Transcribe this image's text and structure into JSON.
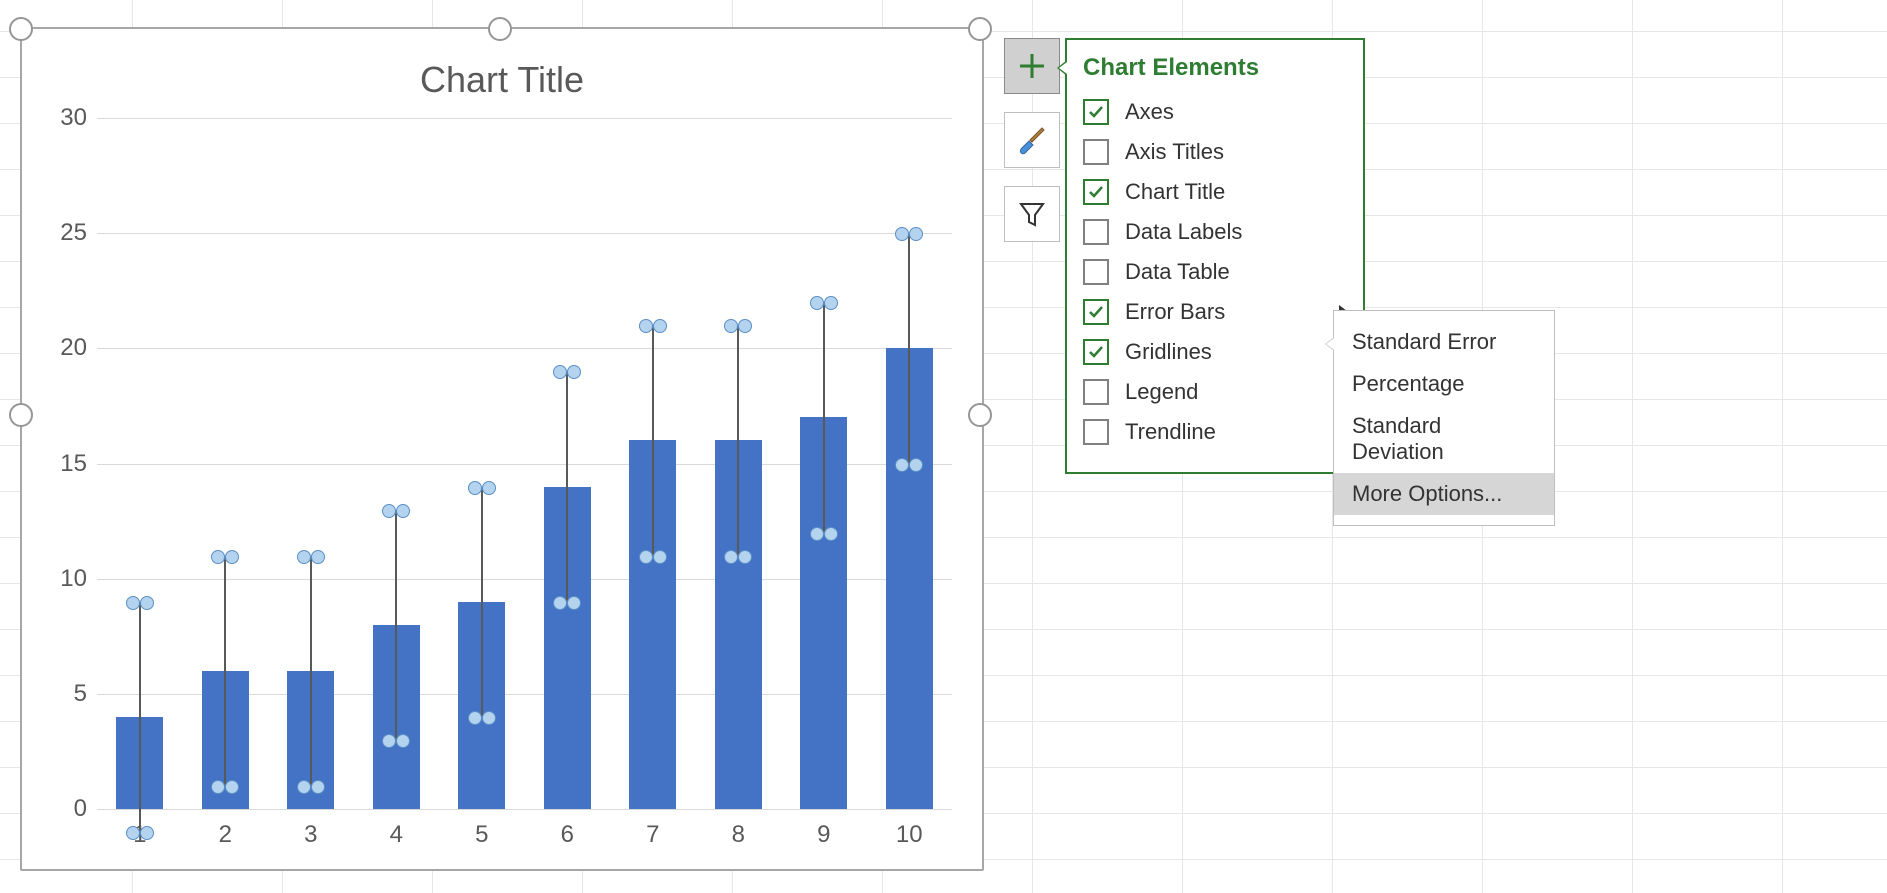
{
  "chart_data": {
    "type": "bar",
    "title": "Chart Title",
    "categories": [
      "1",
      "2",
      "3",
      "4",
      "5",
      "6",
      "7",
      "8",
      "9",
      "10"
    ],
    "values": [
      4,
      6,
      6,
      8,
      9,
      14,
      16,
      16,
      17,
      20
    ],
    "error_bars": {
      "plus": 5,
      "minus": 5,
      "style": "cap-circles"
    },
    "xlabel": "",
    "ylabel": "",
    "ylim": [
      0,
      30
    ],
    "yticks": [
      0,
      5,
      10,
      15,
      20,
      25,
      30
    ],
    "gridlines": true
  },
  "tool_buttons": {
    "elements": "chart-elements",
    "styles": "chart-styles",
    "filter": "chart-filter"
  },
  "chart_elements_panel": {
    "title": "Chart Elements",
    "items": [
      {
        "label": "Axes",
        "checked": true,
        "has_sub": false
      },
      {
        "label": "Axis Titles",
        "checked": false,
        "has_sub": false
      },
      {
        "label": "Chart Title",
        "checked": true,
        "has_sub": false
      },
      {
        "label": "Data Labels",
        "checked": false,
        "has_sub": false
      },
      {
        "label": "Data Table",
        "checked": false,
        "has_sub": false
      },
      {
        "label": "Error Bars",
        "checked": true,
        "has_sub": true
      },
      {
        "label": "Gridlines",
        "checked": true,
        "has_sub": false
      },
      {
        "label": "Legend",
        "checked": false,
        "has_sub": false
      },
      {
        "label": "Trendline",
        "checked": false,
        "has_sub": false
      }
    ]
  },
  "error_bars_submenu": {
    "items": [
      {
        "label": "Standard Error",
        "hover": false
      },
      {
        "label": "Percentage",
        "hover": false
      },
      {
        "label": "Standard Deviation",
        "hover": false
      },
      {
        "label": "More Options...",
        "hover": true
      }
    ]
  }
}
